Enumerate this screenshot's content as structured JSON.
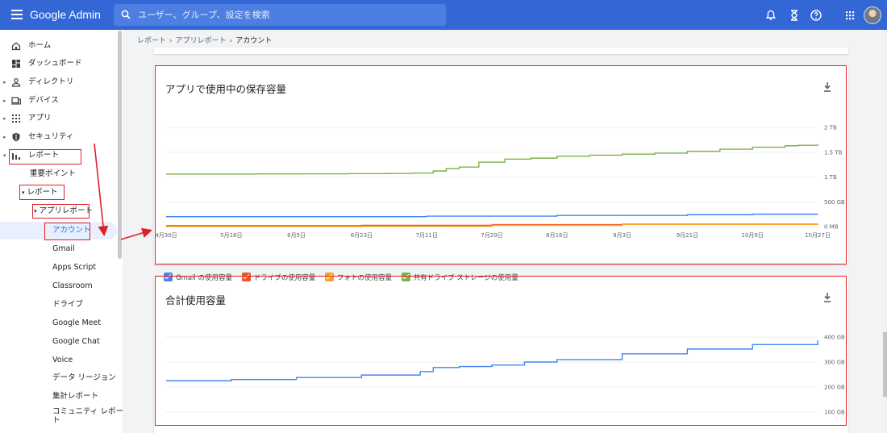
{
  "app": {
    "title": "Google Admin"
  },
  "search": {
    "placeholder": "ユーザー、グループ、設定を検索"
  },
  "sidebar": {
    "items": [
      {
        "label": "ホーム"
      },
      {
        "label": "ダッシュボード"
      },
      {
        "label": "ディレクトリ"
      },
      {
        "label": "デバイス"
      },
      {
        "label": "アプリ"
      },
      {
        "label": "セキュリティ"
      },
      {
        "label": "レポート"
      }
    ],
    "reports": [
      {
        "label": "重要ポイント"
      },
      {
        "label": "レポート"
      },
      {
        "label": "アプリレポート"
      },
      {
        "label": "アカウント"
      },
      {
        "label": "Gmail"
      },
      {
        "label": "Apps Script"
      },
      {
        "label": "Classroom"
      },
      {
        "label": "ドライブ"
      },
      {
        "label": "Google Meet"
      },
      {
        "label": "Google Chat"
      },
      {
        "label": "Voice"
      },
      {
        "label": "データ リージョン"
      },
      {
        "label": "集計レポート"
      },
      {
        "label": "コミュニティ レポー"
      },
      {
        "label": "ト"
      }
    ]
  },
  "breadcrumb": {
    "items": [
      "レポート",
      "アプリレポート",
      "アカウント"
    ],
    "separator": "›"
  },
  "storage_chart": {
    "title": "アプリで使用中の保存容量",
    "legend": [
      "Gmail の使用容量",
      "ドライブの使用容量",
      "フォトの使用容量",
      "共有ドライブ ストレージの使用量"
    ],
    "colors": {
      "gmail": "#4285f4",
      "drive": "#f4511e",
      "photos": "#f6a21d",
      "shared": "#7cb342"
    }
  },
  "total_chart": {
    "title": "合計使用容量",
    "color": "#4285f4"
  },
  "chart_data": [
    {
      "type": "line",
      "title": "アプリで使用中の保存容量",
      "x_ticks": [
        "4月30日",
        "5月18日",
        "6月5日",
        "6月23日",
        "7月11日",
        "7月29日",
        "8月16日",
        "9月3日",
        "9月21日",
        "10月9日",
        "10月27日"
      ],
      "y_ticks": [
        "0 MB",
        "500 GB",
        "1 TB",
        "1.5 TB",
        "2 TB"
      ],
      "ylim": [
        0,
        2000
      ],
      "legend_position": "bottom",
      "series": [
        {
          "name": "共有ドライブ ストレージの使用量",
          "color": "#7cb342",
          "x": [
            0,
            0.07,
            0.14,
            0.21,
            0.28,
            0.34,
            0.38,
            0.41,
            0.43,
            0.45,
            0.48,
            0.52,
            0.56,
            0.6,
            0.65,
            0.7,
            0.75,
            0.8,
            0.85,
            0.9,
            0.95,
            0.97,
            1
          ],
          "values": [
            1060,
            1060,
            1062,
            1064,
            1068,
            1072,
            1080,
            1120,
            1170,
            1200,
            1300,
            1360,
            1380,
            1420,
            1440,
            1460,
            1480,
            1520,
            1560,
            1600,
            1630,
            1640,
            1660
          ]
        },
        {
          "name": "Gmail の使用容量",
          "color": "#4285f4",
          "x": [
            0,
            0.2,
            0.4,
            0.6,
            0.8,
            0.9,
            1
          ],
          "values": [
            200,
            200,
            210,
            225,
            240,
            250,
            260
          ]
        },
        {
          "name": "ドライブの使用容量",
          "color": "#f4511e",
          "x": [
            0,
            0.3,
            0.5,
            0.7,
            1
          ],
          "values": [
            20,
            25,
            40,
            50,
            55
          ]
        },
        {
          "name": "フォトの使用容量",
          "color": "#f6a21d",
          "x": [
            0,
            0.3,
            0.5,
            0.7,
            1
          ],
          "values": [
            2,
            5,
            25,
            45,
            55
          ]
        }
      ]
    },
    {
      "type": "line",
      "title": "合計使用容量",
      "y_ticks": [
        "100 GB",
        "200 GB",
        "300 GB",
        "400 GB"
      ],
      "ylim": [
        100,
        400
      ],
      "series": [
        {
          "color": "#4285f4",
          "x": [
            0,
            0.1,
            0.2,
            0.3,
            0.39,
            0.41,
            0.45,
            0.5,
            0.55,
            0.6,
            0.7,
            0.8,
            0.9,
            1
          ],
          "values": [
            225,
            230,
            238,
            248,
            262,
            278,
            282,
            288,
            300,
            310,
            333,
            352,
            370,
            388
          ]
        }
      ]
    }
  ]
}
